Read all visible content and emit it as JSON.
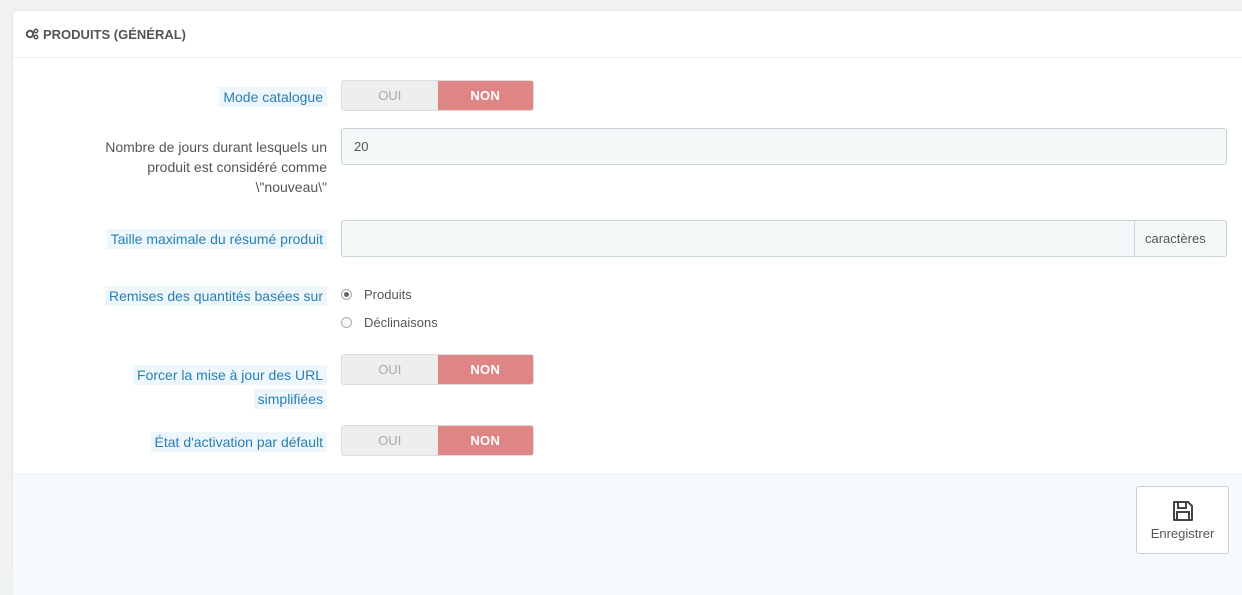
{
  "panel": {
    "title": "PRODUITS (GÉNÉRAL)",
    "icon": "cogs-icon"
  },
  "fields": {
    "catalog_mode": {
      "label": "Mode catalogue",
      "yes": "OUI",
      "no": "NON",
      "value": "NON"
    },
    "new_days": {
      "label_line1": "Nombre de jours durant lesquels un",
      "label_line2": "produit est considéré comme",
      "label_line3": "\\\"nouveau\\\"",
      "value": "20"
    },
    "summary_max": {
      "label": "Taille maximale du résumé produit",
      "value": "",
      "addon": "caractères"
    },
    "quantity_discount": {
      "label": "Remises des quantités basées sur",
      "options": [
        "Produits",
        "Déclinaisons"
      ],
      "selected": "Produits"
    },
    "force_url": {
      "label_line1": "Forcer la mise à jour des URL",
      "label_line2": "simplifiées",
      "yes": "OUI",
      "no": "NON",
      "value": "NON"
    },
    "default_active": {
      "label": "État d'activation par défault",
      "yes": "OUI",
      "no": "NON",
      "value": "NON"
    }
  },
  "footer": {
    "save_label": "Enregistrer",
    "save_icon": "floppy-disk-icon"
  },
  "colors": {
    "accent_off": "#e08585",
    "label_hint_bg": "#edf7fb",
    "label_hint_text": "#2a7fb4"
  }
}
